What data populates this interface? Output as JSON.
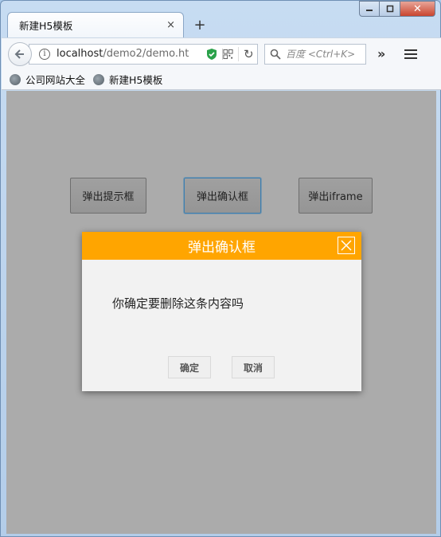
{
  "browser": {
    "tab_title": "新建H5模板",
    "tab_close": "×",
    "new_tab": "+",
    "url_host": "localhost",
    "url_path": "/demo2/demo.ht",
    "search_placeholder": "百度 <Ctrl+K>",
    "overflow": "»",
    "close_glyph": "✕"
  },
  "bookmarks": [
    {
      "label": "公司网站大全"
    },
    {
      "label": "新建H5模板"
    }
  ],
  "page": {
    "buttons": [
      {
        "label": "弹出提示框"
      },
      {
        "label": "弹出确认框"
      },
      {
        "label": "弹出iframe"
      }
    ]
  },
  "modal": {
    "title": "弹出确认框",
    "message": "你确定要删除这条内容吗",
    "ok_label": "确定",
    "cancel_label": "取消",
    "header_color": "#ffa500"
  }
}
